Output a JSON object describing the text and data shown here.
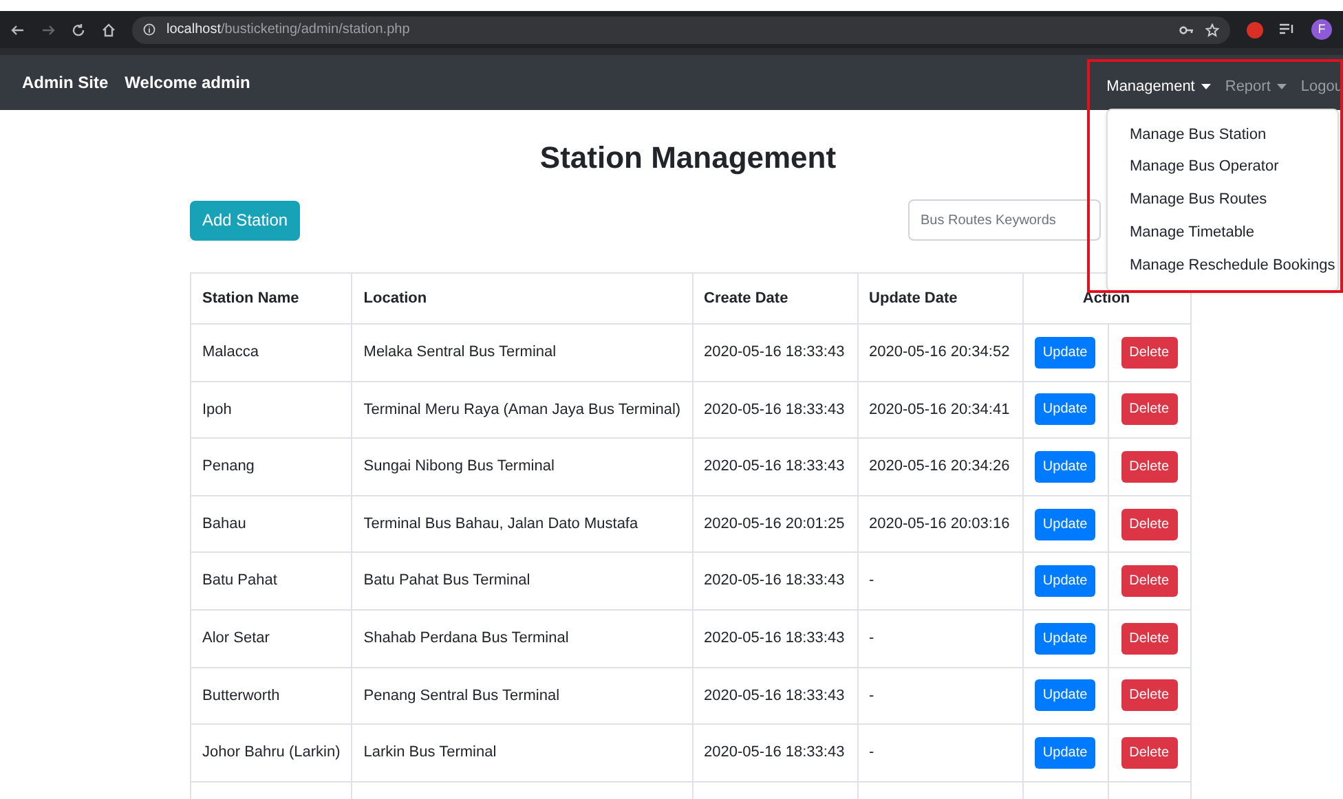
{
  "browser": {
    "url_host": "localhost",
    "url_path": "/busticketing/admin/station.php",
    "profile_initial": "F"
  },
  "navbar": {
    "brand": "Admin Site",
    "welcome": "Welcome admin",
    "menus": [
      {
        "label": "Management",
        "dropdown": true,
        "expanded": true
      },
      {
        "label": "Report",
        "dropdown": true,
        "expanded": false
      },
      {
        "label": "Logou",
        "dropdown": false,
        "expanded": false
      }
    ]
  },
  "dropdown": {
    "items": [
      "Manage Bus Station",
      "Manage Bus Operator",
      "Manage Bus Routes",
      "Manage Timetable",
      "Manage Reschedule Bookings"
    ]
  },
  "page": {
    "title": "Station Management",
    "add_button": "Add Station",
    "search": {
      "placeholder": "Bus Routes Keywords"
    }
  },
  "table": {
    "columns": [
      "Station Name",
      "Location",
      "Create Date",
      "Update Date",
      "Action"
    ],
    "rows": [
      {
        "name": "Malacca",
        "location": "Melaka Sentral Bus Terminal",
        "created": "2020-05-16 18:33:43",
        "updated": "2020-05-16 20:34:52",
        "update_button": "Update",
        "delete_button": "Delete"
      },
      {
        "name": "Ipoh",
        "location": "Terminal Meru Raya (Aman Jaya Bus Terminal)",
        "created": "2020-05-16 18:33:43",
        "updated": "2020-05-16 20:34:41",
        "update_button": "Update",
        "delete_button": "Delete"
      },
      {
        "name": "Penang",
        "location": "Sungai Nibong Bus Terminal",
        "created": "2020-05-16 18:33:43",
        "updated": "2020-05-16 20:34:26",
        "update_button": "Update",
        "delete_button": "Delete"
      },
      {
        "name": "Bahau",
        "location": "Terminal Bus Bahau, Jalan Dato Mustafa",
        "created": "2020-05-16 20:01:25",
        "updated": "2020-05-16 20:03:16",
        "update_button": "Update",
        "delete_button": "Delete"
      },
      {
        "name": "Batu Pahat",
        "location": "Batu Pahat Bus Terminal",
        "created": "2020-05-16 18:33:43",
        "updated": "-",
        "update_button": "Update",
        "delete_button": "Delete"
      },
      {
        "name": "Alor Setar",
        "location": "Shahab Perdana Bus Terminal",
        "created": "2020-05-16 18:33:43",
        "updated": "-",
        "update_button": "Update",
        "delete_button": "Delete"
      },
      {
        "name": "Butterworth",
        "location": "Penang Sentral Bus Terminal",
        "created": "2020-05-16 18:33:43",
        "updated": "-",
        "update_button": "Update",
        "delete_button": "Delete"
      },
      {
        "name": "Johor Bahru (Larkin)",
        "location": "Larkin Bus Terminal",
        "created": "2020-05-16 18:33:43",
        "updated": "-",
        "update_button": "Update",
        "delete_button": "Delete"
      }
    ]
  }
}
